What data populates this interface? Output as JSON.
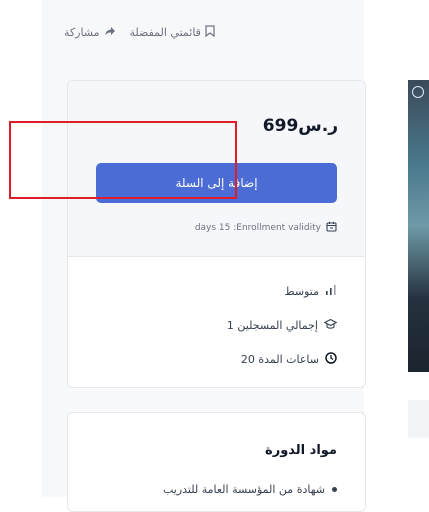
{
  "topbar": {
    "share_label": "مشاركة",
    "wishlist_label": "قائمتي المفضلة"
  },
  "purchase": {
    "price": "ر.س699",
    "add_to_cart_label": "إضافة إلى السلة",
    "enrollment_validity": "days 15 :Enrollment validity"
  },
  "course_meta": {
    "level": "متوسط",
    "enrolled": "1 إجمالي المسجلين",
    "duration": "20 ساعات المدة"
  },
  "materials": {
    "title": "مواد الدورة",
    "items": [
      "شهادة من المؤسسة العامة للتدريب"
    ]
  },
  "colors": {
    "primary_button": "#4a6cd4",
    "highlight_box": "#e11d2a"
  },
  "icons": {
    "share": "share-arrow-icon",
    "wishlist": "bookmark-icon",
    "validity": "calendar-icon",
    "level": "level-bars-icon",
    "enrolled": "graduation-cap-icon",
    "duration": "clock-icon"
  }
}
